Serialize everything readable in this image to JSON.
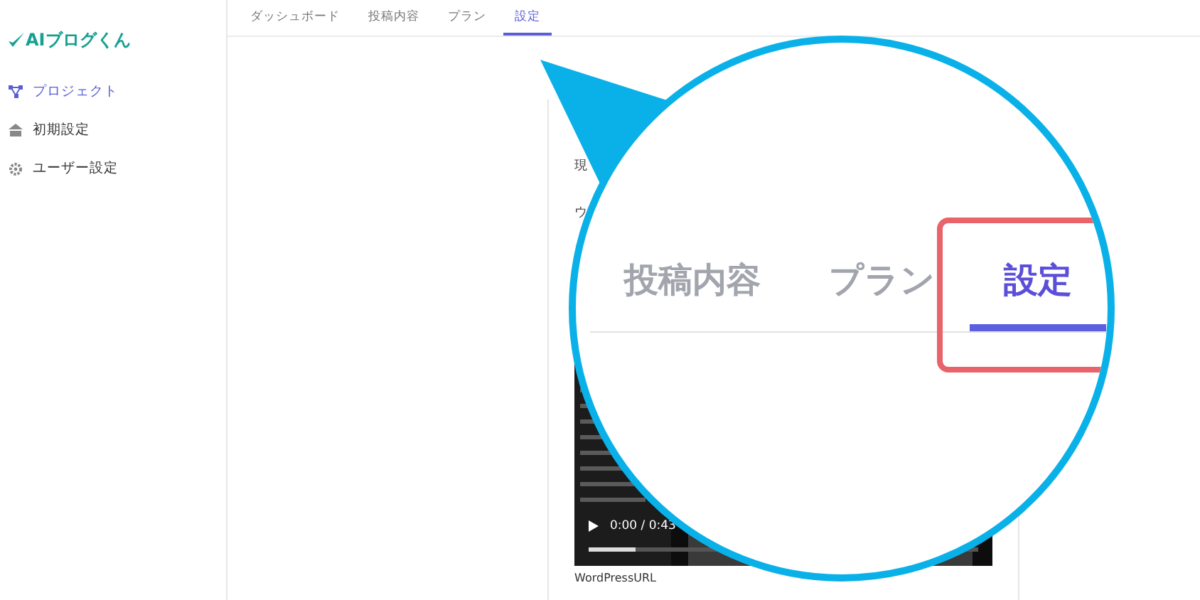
{
  "sidebar": {
    "logo": "AIブログくん",
    "items": [
      {
        "label": "プロジェクト",
        "kind": "project",
        "selected": true
      },
      {
        "label": "初期設定",
        "kind": "building",
        "selected": false
      },
      {
        "label": "ユーザー設定",
        "kind": "gear",
        "selected": false
      }
    ]
  },
  "tabs": [
    {
      "label": "ダッシュボード",
      "selected": false
    },
    {
      "label": "投稿内容",
      "selected": false
    },
    {
      "label": "プラン",
      "selected": false
    },
    {
      "label": "設定",
      "selected": true
    }
  ],
  "card": {
    "texts": [
      "現",
      "ウ"
    ],
    "video": {
      "time": "0:00 / 0:43",
      "level": 0.12
    },
    "field_label": "WordPressURL"
  },
  "magnifier": {
    "tabs": [
      {
        "label": "投稿内容",
        "selected": false
      },
      {
        "label": "プラン",
        "selected": false
      },
      {
        "label": "設定",
        "selected": true
      }
    ]
  }
}
